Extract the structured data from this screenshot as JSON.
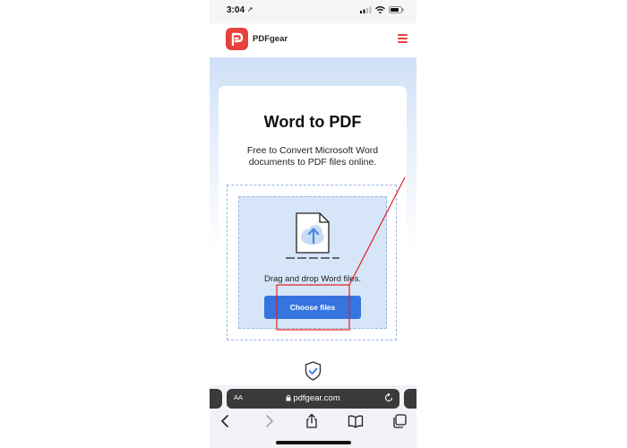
{
  "status_bar": {
    "time": "3:04"
  },
  "header": {
    "brand": "PDFgear"
  },
  "hero": {
    "title": "Word to PDF",
    "subtitle": "Free to Convert Microsoft Word documents to PDF files online."
  },
  "upload": {
    "drag_text": "Drag and drop Word files.",
    "button_label": "Choose files"
  },
  "browser": {
    "text_size_button": "AA",
    "url": "pdfgear.com"
  },
  "icons": [
    "location-arrow-icon",
    "signal-icon",
    "wifi-icon",
    "battery-icon",
    "hamburger-menu-icon",
    "cloud-upload-file-icon",
    "shield-check-icon",
    "lock-icon",
    "reload-icon",
    "back-arrow-icon",
    "forward-arrow-icon",
    "share-icon",
    "bookmarks-icon",
    "tabs-icon"
  ],
  "colors": {
    "brand_red": "#e8403a",
    "primary_blue": "#3675e0",
    "annotation_red": "#e02020",
    "dropzone_bg": "#d6e5f8"
  }
}
